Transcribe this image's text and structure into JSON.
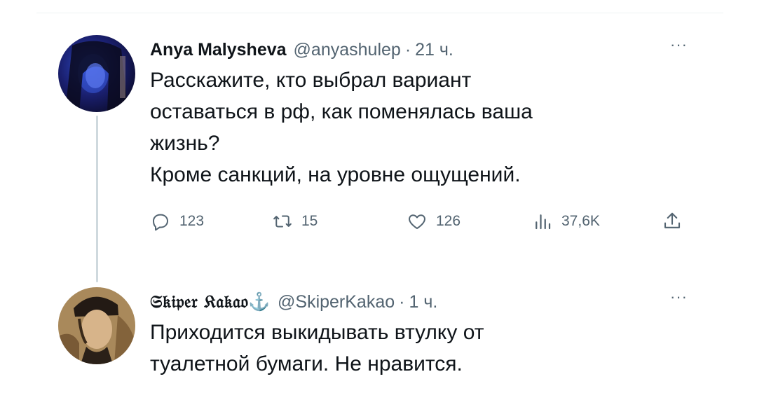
{
  "tweets": [
    {
      "author_name": "Anya Malysheva",
      "handle": "@anyashulep",
      "separator": "·",
      "time": "21 ч.",
      "more": "···",
      "text": "Расскажите, кто выбрал вариант\nоставаться в рф, как поменялась ваша\nжизнь?\nКроме санкций, на уровне ощущений.",
      "stats": {
        "replies": "123",
        "retweets": "15",
        "likes": "126",
        "views": "37,6K"
      }
    },
    {
      "author_name": "𝔖𝔨𝔦𝔭𝔢𝔯 𝔎𝔞𝔨𝔞𝔬⚓",
      "author_prefix": "⚓",
      "handle": "@SkiperKakao",
      "separator": "·",
      "time": "1 ч.",
      "more": "···",
      "text": "Приходится выкидывать втулку от\nтуалетной бумаги. Не нравится."
    }
  ],
  "colors": {
    "text": "#0f1419",
    "secondary": "#536471",
    "thread_line": "#cfd9de"
  },
  "icons": [
    "reply-icon",
    "retweet-icon",
    "like-icon",
    "views-icon",
    "share-icon",
    "more-icon"
  ]
}
